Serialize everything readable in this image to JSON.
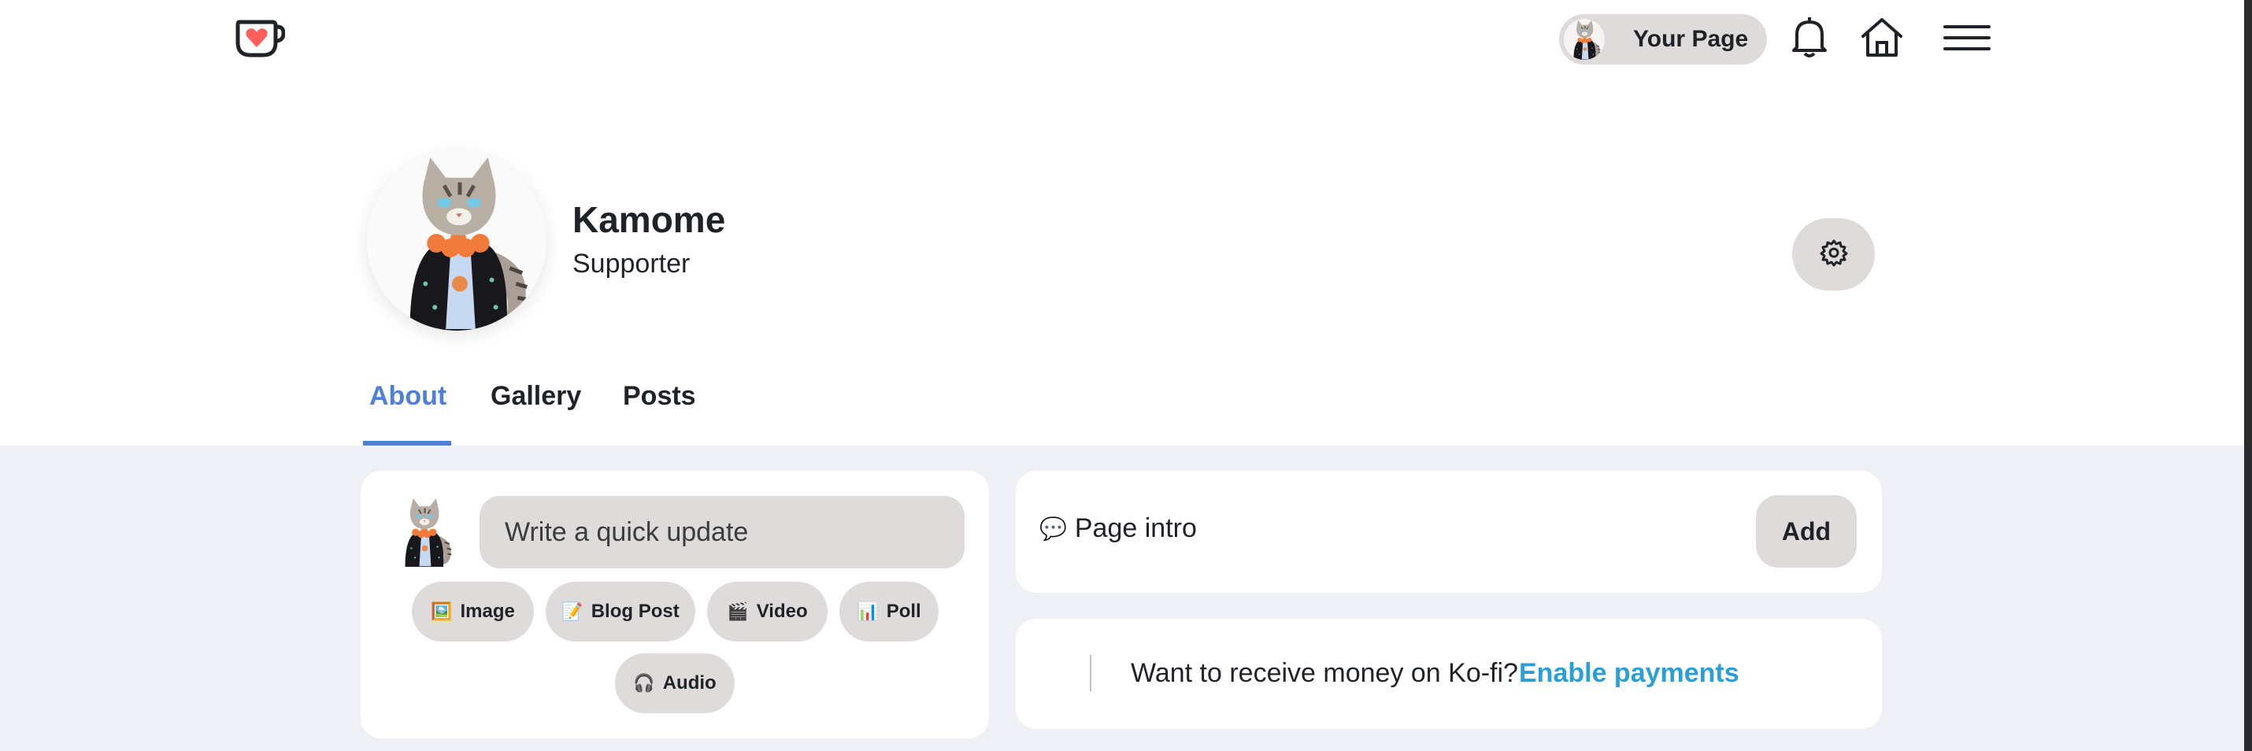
{
  "nav": {
    "logo_icon": "ko-fi-cup-icon",
    "your_page_label": "Your Page",
    "icons": [
      "bell-icon",
      "home-icon",
      "menu-icon"
    ]
  },
  "profile": {
    "name": "Kamome",
    "role": "Supporter",
    "settings_icon": "gear-icon"
  },
  "tabs": [
    {
      "label": "About",
      "active": true
    },
    {
      "label": "Gallery",
      "active": false
    },
    {
      "label": "Posts",
      "active": false
    }
  ],
  "update_card": {
    "placeholder": "Write a quick update",
    "buttons": [
      {
        "emoji": "🖼️",
        "label": "Image"
      },
      {
        "emoji": "📝",
        "label": "Blog Post"
      },
      {
        "emoji": "🎬",
        "label": "Video"
      },
      {
        "emoji": "📊",
        "label": "Poll"
      },
      {
        "emoji": "🎧",
        "label": "Audio"
      }
    ]
  },
  "intro_card": {
    "emoji": "💬",
    "label": "Page intro",
    "add_label": "Add"
  },
  "payments_card": {
    "text": "Want to receive money on Ko-fi?",
    "link": "Enable payments"
  },
  "colors": {
    "accent_blue": "#4f7fd6",
    "link_blue": "#2a9fd6",
    "pill_gray": "#dfdbdb",
    "body_bg": "#eef0f5",
    "logo_red": "#ff5e5b"
  }
}
